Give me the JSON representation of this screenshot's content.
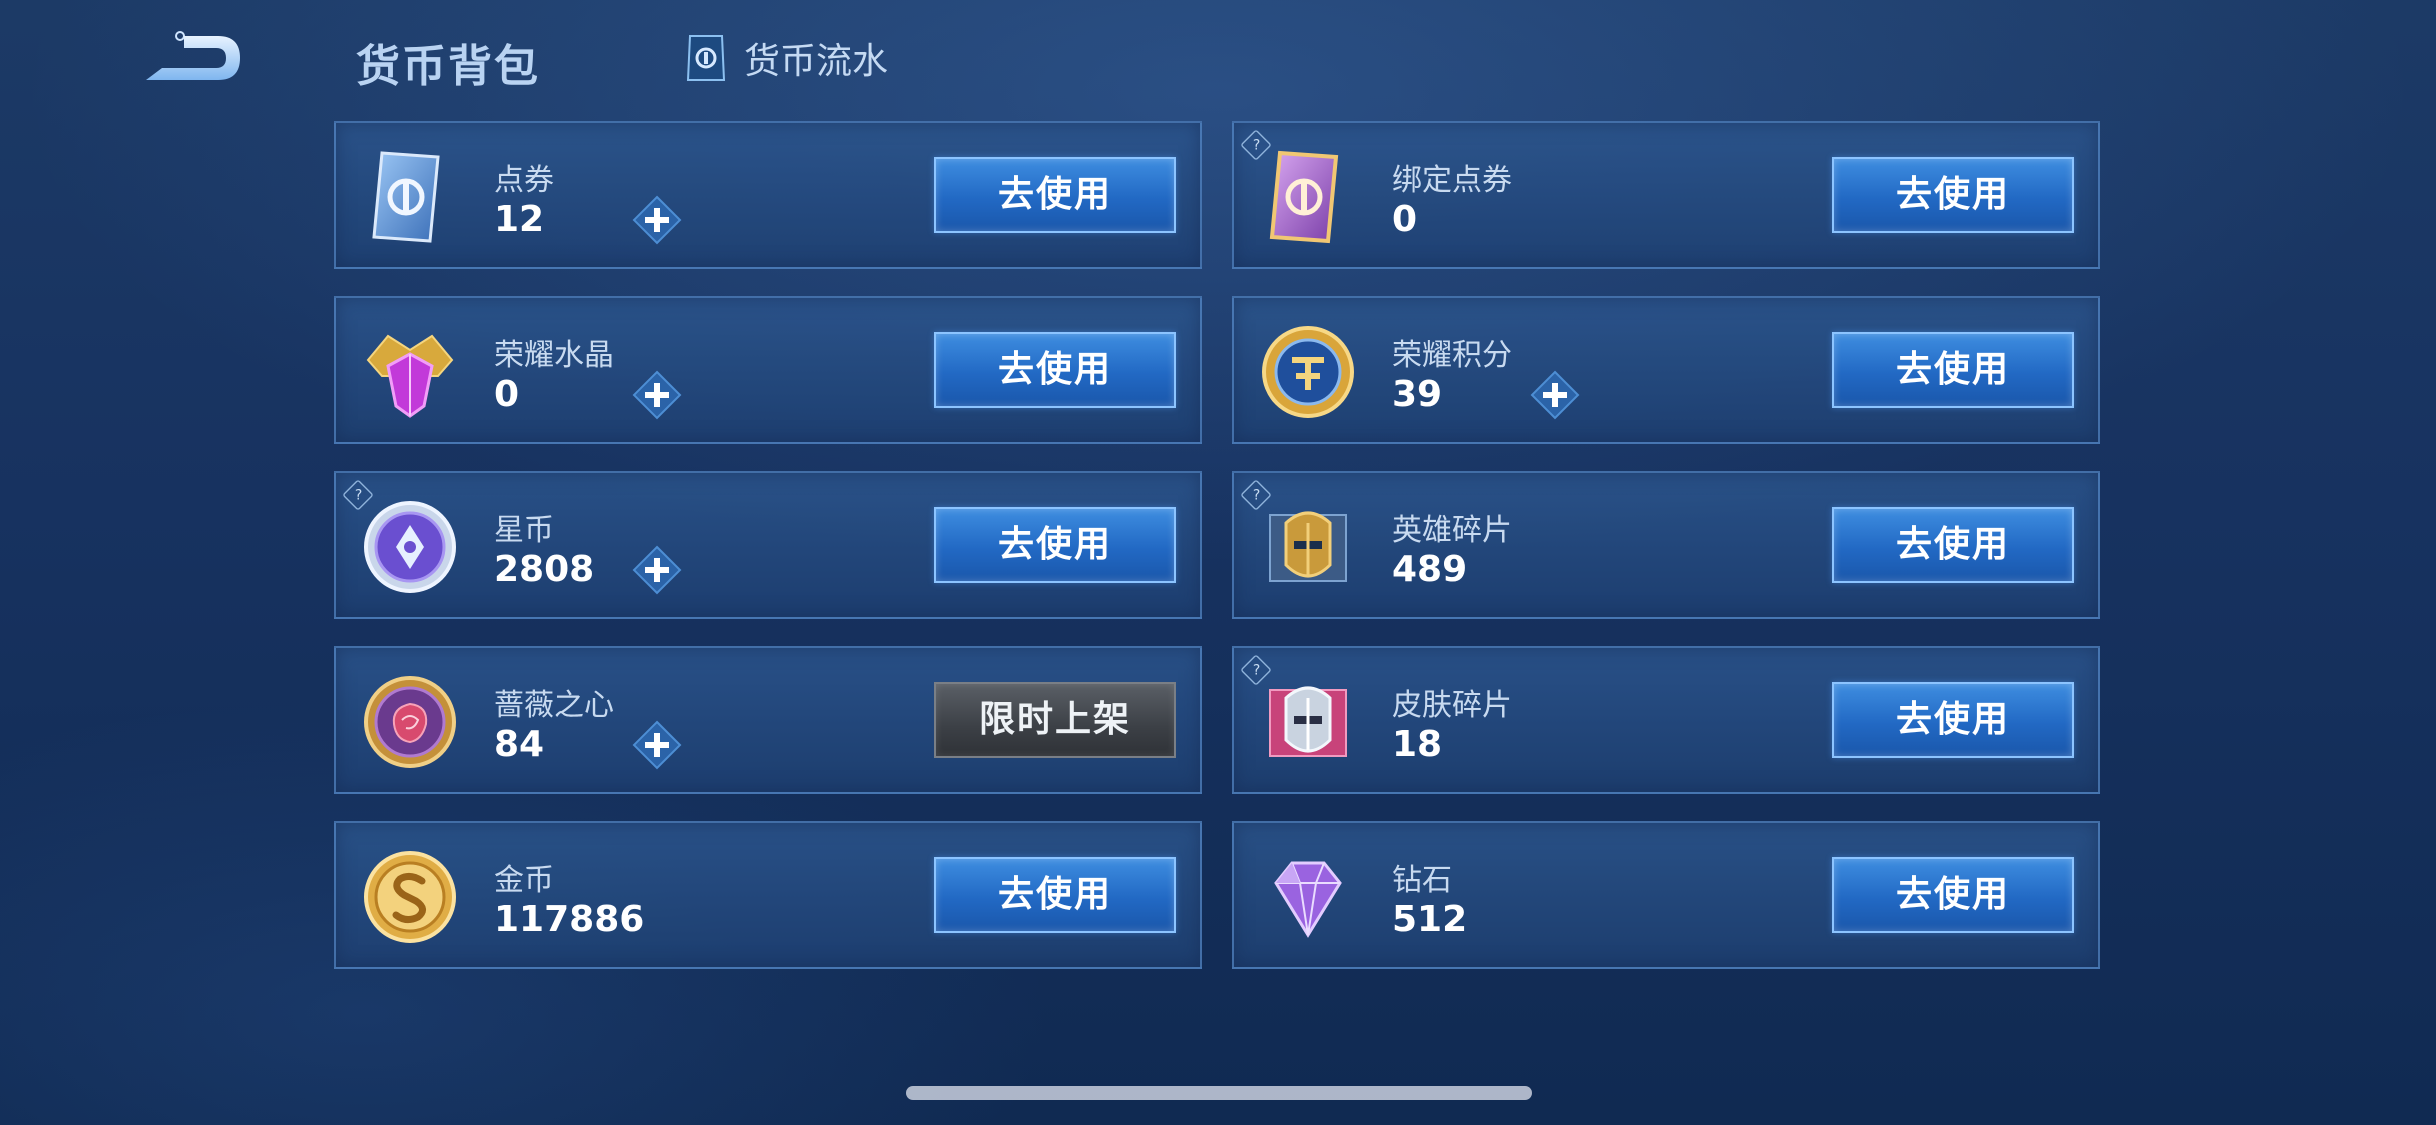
{
  "header": {
    "title": "货币背包",
    "flow_link": "货币流水"
  },
  "currencies": [
    {
      "name": "点券",
      "amount": "12",
      "button": "去使用"
    },
    {
      "name": "绑定点券",
      "amount": "0",
      "button": "去使用"
    },
    {
      "name": "荣耀水晶",
      "amount": "0",
      "button": "去使用"
    },
    {
      "name": "荣耀积分",
      "amount": "39",
      "button": "去使用"
    },
    {
      "name": "星币",
      "amount": "2808",
      "button": "去使用"
    },
    {
      "name": "英雄碎片",
      "amount": "489",
      "button": "去使用"
    },
    {
      "name": "蔷薇之心",
      "amount": "84",
      "button": "限时上架"
    },
    {
      "name": "皮肤碎片",
      "amount": "18",
      "button": "去使用"
    },
    {
      "name": "金币",
      "amount": "117886",
      "button": "去使用"
    },
    {
      "name": "钻石",
      "amount": "512",
      "button": "去使用"
    }
  ],
  "help_mark": "?",
  "icons": {
    "back": "back-arrow-icon",
    "flow": "coupon-flow-icon",
    "plus": "plus-icon"
  },
  "colors": {
    "primary_button": "#2a74cf",
    "disabled_button": "#45494f",
    "card_border": "#5f96d6",
    "background": "#173260"
  }
}
